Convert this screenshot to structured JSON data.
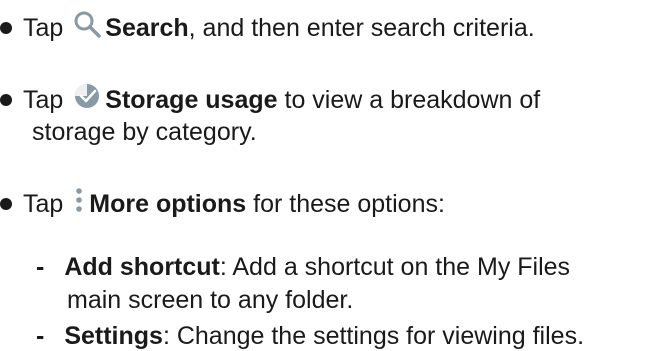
{
  "items": [
    {
      "tap": "Tap",
      "icon": "search-icon",
      "term": "Search",
      "rest": ", and then enter search criteria."
    },
    {
      "tap": "Tap",
      "icon": "storage-usage-icon",
      "term": "Storage usage",
      "rest": " to view a breakdown of",
      "rest2": "storage by category."
    },
    {
      "tap": "Tap",
      "icon": "more-options-icon",
      "term": "More options",
      "rest": " for these options:",
      "subitems": [
        {
          "dash": "-",
          "term": "Add shortcut",
          "rest": ": Add a shortcut on the My Files",
          "rest2": "main screen to any folder."
        },
        {
          "dash": "-",
          "term": "Settings",
          "rest": ": Change the settings for viewing files."
        }
      ]
    }
  ],
  "colors": {
    "text": "#1a1a1a",
    "icon": "#8a9aa5"
  }
}
